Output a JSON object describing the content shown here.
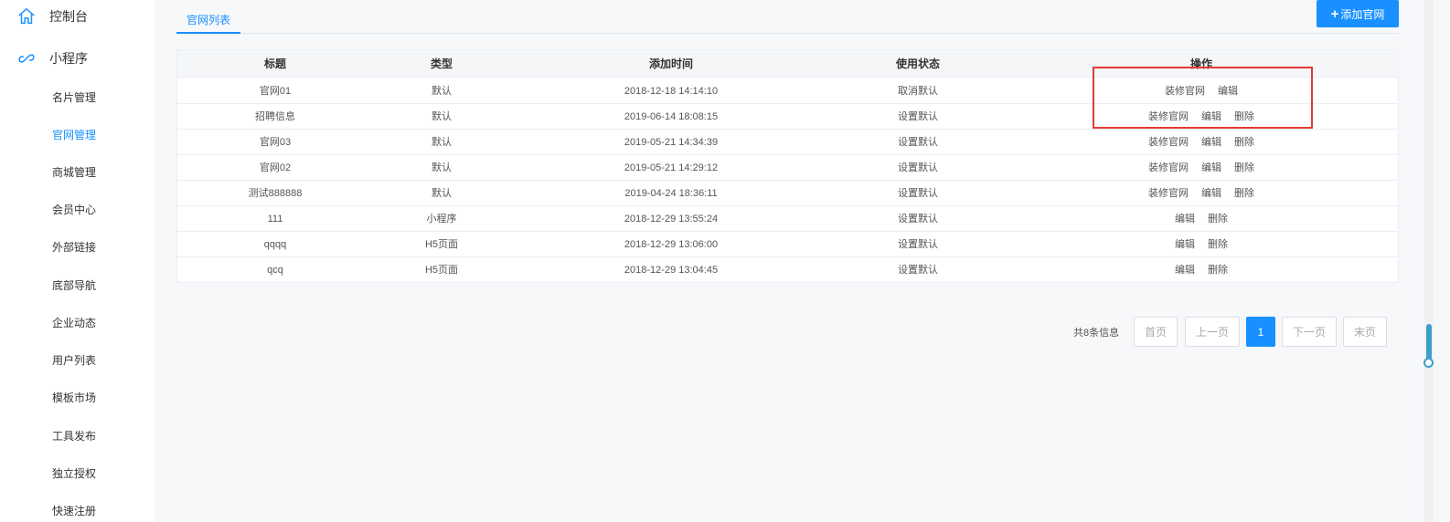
{
  "sidebar": {
    "top": [
      {
        "label": "控制台",
        "icon": "home-icon"
      },
      {
        "label": "小程序",
        "icon": "link-icon"
      }
    ],
    "sub": [
      {
        "label": "名片管理",
        "active": false
      },
      {
        "label": "官网管理",
        "active": true
      },
      {
        "label": "商城管理",
        "active": false
      },
      {
        "label": "会员中心",
        "active": false
      },
      {
        "label": "外部链接",
        "active": false
      },
      {
        "label": "底部导航",
        "active": false
      },
      {
        "label": "企业动态",
        "active": false
      },
      {
        "label": "用户列表",
        "active": false
      },
      {
        "label": "模板市场",
        "active": false
      },
      {
        "label": "工具发布",
        "active": false
      },
      {
        "label": "独立授权",
        "active": false
      },
      {
        "label": "快速注册",
        "active": false
      }
    ]
  },
  "header": {
    "tab": "官网列表",
    "add_button": "添加官网"
  },
  "table": {
    "columns": [
      "标题",
      "类型",
      "添加时间",
      "使用状态",
      "操作"
    ],
    "rows": [
      {
        "title": "官网01",
        "type": "默认",
        "time": "2018-12-18 14:14:10",
        "status": "取消默认",
        "ops": [
          "装修官网",
          "编辑"
        ]
      },
      {
        "title": "招聘信息",
        "type": "默认",
        "time": "2019-06-14 18:08:15",
        "status": "设置默认",
        "ops": [
          "装修官网",
          "编辑",
          "删除"
        ]
      },
      {
        "title": "官网03",
        "type": "默认",
        "time": "2019-05-21 14:34:39",
        "status": "设置默认",
        "ops": [
          "装修官网",
          "编辑",
          "删除"
        ]
      },
      {
        "title": "官网02",
        "type": "默认",
        "time": "2019-05-21 14:29:12",
        "status": "设置默认",
        "ops": [
          "装修官网",
          "编辑",
          "删除"
        ]
      },
      {
        "title": "测试888888",
        "type": "默认",
        "time": "2019-04-24 18:36:11",
        "status": "设置默认",
        "ops": [
          "装修官网",
          "编辑",
          "删除"
        ]
      },
      {
        "title": "111",
        "type": "小程序",
        "time": "2018-12-29 13:55:24",
        "status": "设置默认",
        "ops": [
          "编辑",
          "删除"
        ]
      },
      {
        "title": "qqqq",
        "type": "H5页面",
        "time": "2018-12-29 13:06:00",
        "status": "设置默认",
        "ops": [
          "编辑",
          "删除"
        ]
      },
      {
        "title": "qcq",
        "type": "H5页面",
        "time": "2018-12-29 13:04:45",
        "status": "设置默认",
        "ops": [
          "编辑",
          "删除"
        ]
      }
    ]
  },
  "pagination": {
    "total": "共8条信息",
    "first": "首页",
    "prev": "上一页",
    "current": "1",
    "next": "下一页",
    "last": "末页"
  },
  "colors": {
    "accent": "#1890ff",
    "highlight": "#e53935"
  }
}
